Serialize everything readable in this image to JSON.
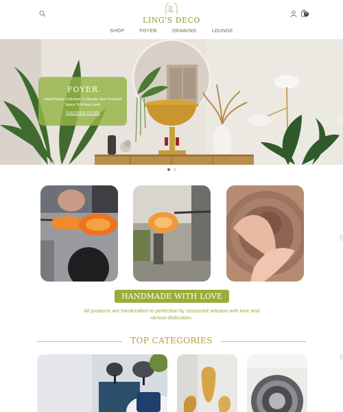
{
  "header": {
    "logo_text": "LING'S DECO",
    "cart_count": "0",
    "icons": {
      "search": "search-icon",
      "user": "user-icon",
      "cart": "bag-icon",
      "logo": "monogram-icon"
    }
  },
  "nav": {
    "items": [
      "SHOP",
      "FOYER",
      "DRAWING",
      "LOUNGE"
    ]
  },
  "hero": {
    "title": "FOYER",
    "subtitle": "Hand Picked Collection To Elevate Your Personal Space To A New Level",
    "cta": "DISCOVER FOYER",
    "slides_total": 2,
    "active_slide": 1
  },
  "handmade": {
    "title": "HANDMADE WITH LOVE",
    "text": "All products are handcrafted to perfection by seasoned artisans with love and utmost dedication."
  },
  "categories": {
    "title": "TOP CATEGORIES"
  },
  "colors": {
    "accent": "#9aad3a",
    "gold": "#b89a3a",
    "brand_text": "#8c9a2a"
  }
}
